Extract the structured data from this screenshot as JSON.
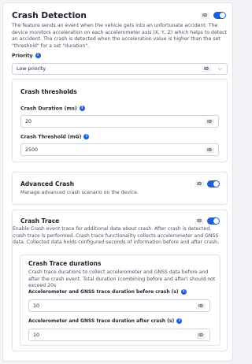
{
  "header": {
    "title": "Crash Detection",
    "id_badge": "ID",
    "enabled": true,
    "description": "The feature sends an event when the vehicle gets into an unfortunate accident. The device monitors acceleration on each accelerometer axis (X, Y, Z) which helps to detect an accident. The crash is detected when the acceleration value is higher than the set \"threshold\" for a set \"duration\"."
  },
  "priority": {
    "label": "Priority",
    "value": "Low priority",
    "id_badge": "ID"
  },
  "crash_thresholds": {
    "title": "Crash thresholds",
    "duration_label": "Crash Duration (ms)",
    "duration_value": "20",
    "threshold_label": "Crash Threshold (mG)",
    "threshold_value": "2500",
    "id_badge": "ID"
  },
  "advanced_crash": {
    "title": "Advanced Crash",
    "description": "Manage advanced crash scenario on the device.",
    "id_badge": "ID",
    "enabled": true
  },
  "crash_trace": {
    "title": "Crash Trace",
    "id_badge": "ID",
    "enabled": true,
    "description": "Enable Crash event trace for additional data about crash. After crash is detected, crash trace is performed. Crash trace functionality collects accelerometer and GNSS data. Collected data holds configured seconds of information before and after crash.",
    "durations": {
      "title": "Crash Trace durations",
      "description": "Crash trace durations to collect accelerometer and GNSS data before and after the crash event. Total duration (combining before and after) should not exceed 20s",
      "before_label": "Accelerometer and GNSS trace duration before crash (s)",
      "before_value": "10",
      "after_label": "Accelerometer and GNSS trace duration after crash (s)",
      "after_value": "10",
      "id_badge": "ID"
    }
  },
  "icons": {
    "info": "info-icon",
    "chevron": "chevron-down-icon"
  },
  "colors": {
    "accent": "#1f5fd1"
  }
}
